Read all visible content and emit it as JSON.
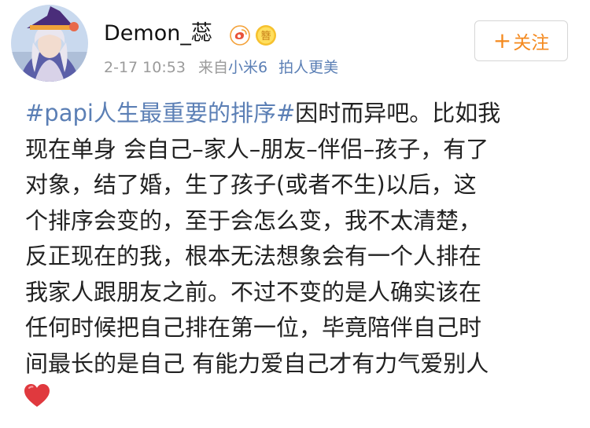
{
  "user": {
    "name": "Demon_蕊",
    "weibo_badge_icon": "weibo-logo-icon",
    "vip_badge_icon": "vip-badge-icon",
    "vip_badge_text": "簪"
  },
  "meta": {
    "time": "2-17 10:53",
    "from_label": "来自",
    "source": "小米6",
    "source_suffix": "拍人更美"
  },
  "follow_button": {
    "plus": "+",
    "label": "关注"
  },
  "post": {
    "topic": "#papi人生最重要的排序#",
    "lines": [
      "因时而异吧。比如我",
      "现在单身 会自己–家人–朋友–伴侣–孩子，有了",
      "对象，结了婚，生了孩子(或者不生)以后，这",
      "个排序会变的，至于会怎么变，我不太清楚，",
      "反正现在的我，根本无法想象会有一个人排在",
      "我家人跟朋友之前。不过不变的是人确实该在",
      "任何时候把自己排在第一位，毕竟陪伴自己时",
      "间最长的是自己 有能力爱自己才有力气爱别人"
    ],
    "end_icon": "red-heart-icon"
  },
  "colors": {
    "link": "#5b7fb5",
    "meta": "#9b9b9b",
    "follow": "#f4891e",
    "heart": "#e0393e"
  }
}
